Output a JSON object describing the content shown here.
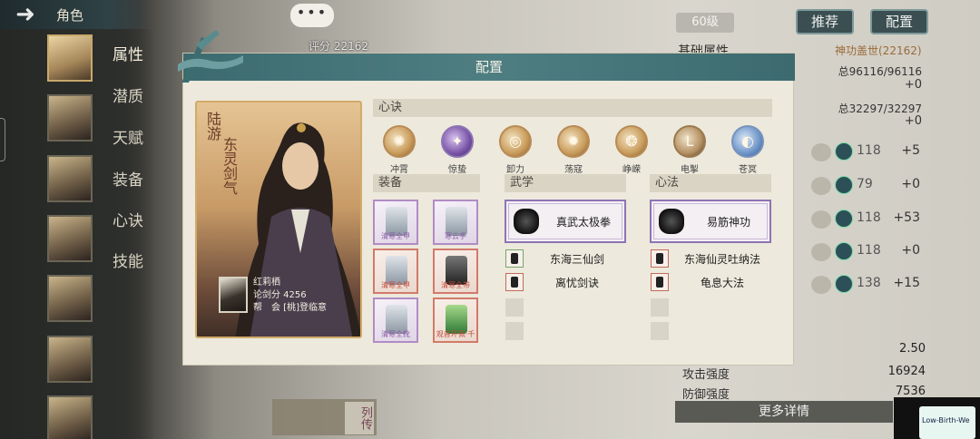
{
  "topbar": {
    "title": "角色"
  },
  "sidebar": {
    "tabs": [
      "属性",
      "潜质",
      "天赋",
      "装备",
      "心诀",
      "技能"
    ]
  },
  "scene": {
    "chat_glyph": "•••",
    "score_label": "评分 22162",
    "level": "60级",
    "buttons": {
      "recommend": "推荐",
      "config": "配置"
    },
    "stats_title": "基础属性",
    "stats_value": "神功盖世(22162)",
    "hp": "总96116/96116",
    "hp_plus": "+0",
    "mp": "总32297/32297",
    "mp_plus": "+0",
    "rows": [
      {
        "num": "118",
        "delta": "+5"
      },
      {
        "num": "79",
        "delta": "+0"
      },
      {
        "num": "118",
        "delta": "+53"
      },
      {
        "num": "118",
        "delta": "+0"
      },
      {
        "num": "138",
        "delta": "+15"
      }
    ],
    "stat_val_1": "2.50",
    "stat_label_2": "攻击强度",
    "stat_val_2": "16924",
    "stat_label_3": "防御强度",
    "stat_val_3": "7536",
    "more": "更多详情",
    "bottom_tag": "列传",
    "web_thumb": "Low-Birth-We"
  },
  "modal": {
    "title": "配置",
    "character": {
      "tag": "陆游",
      "name": "东灵剑气",
      "owner_name": "红莉栖",
      "owner_score": "论剑分 4256",
      "owner_guild": "帮　会 [桃]登临意"
    },
    "sections": {
      "xinjue": "心诀",
      "equip": "装备",
      "wuxue": "武学",
      "xinfa": "心法"
    },
    "skills": [
      {
        "name": "冲霄",
        "glyph": "✺",
        "style": "gold"
      },
      {
        "name": "惊蛰",
        "glyph": "✦",
        "style": "purple"
      },
      {
        "name": "卸力",
        "glyph": "◎",
        "style": "gold"
      },
      {
        "name": "荡寇",
        "glyph": "✹",
        "style": "gold"
      },
      {
        "name": "峥嵘",
        "glyph": "❂",
        "style": "gold"
      },
      {
        "name": "电掣",
        "glyph": "L",
        "style": "dark"
      },
      {
        "name": "苍冥",
        "glyph": "◐",
        "style": "blue"
      }
    ],
    "equipment": [
      {
        "label": "清寒全甲",
        "style": "purple",
        "shape": "light"
      },
      {
        "label": "寒云手",
        "style": "purple",
        "shape": "light"
      },
      {
        "label": "清寒全甲",
        "style": "red",
        "shape": "light"
      },
      {
        "label": "清寒全带",
        "style": "red",
        "shape": "dark"
      },
      {
        "label": "清寒全靴",
        "style": "purple",
        "shape": "light"
      },
      {
        "label": "观音环佩·千",
        "style": "red",
        "shape": "green"
      }
    ],
    "wuxue": {
      "main": "真武太极拳",
      "sub": [
        "东海三仙剑",
        "离忧剑诀"
      ]
    },
    "xinfa": {
      "main": "易筋神功",
      "sub": [
        "东海仙灵吐纳法",
        "龟息大法"
      ]
    },
    "colors": {
      "header": "#4f7e82",
      "accent_purple": "#8e74b4",
      "accent_red": "#d27a6a"
    }
  }
}
